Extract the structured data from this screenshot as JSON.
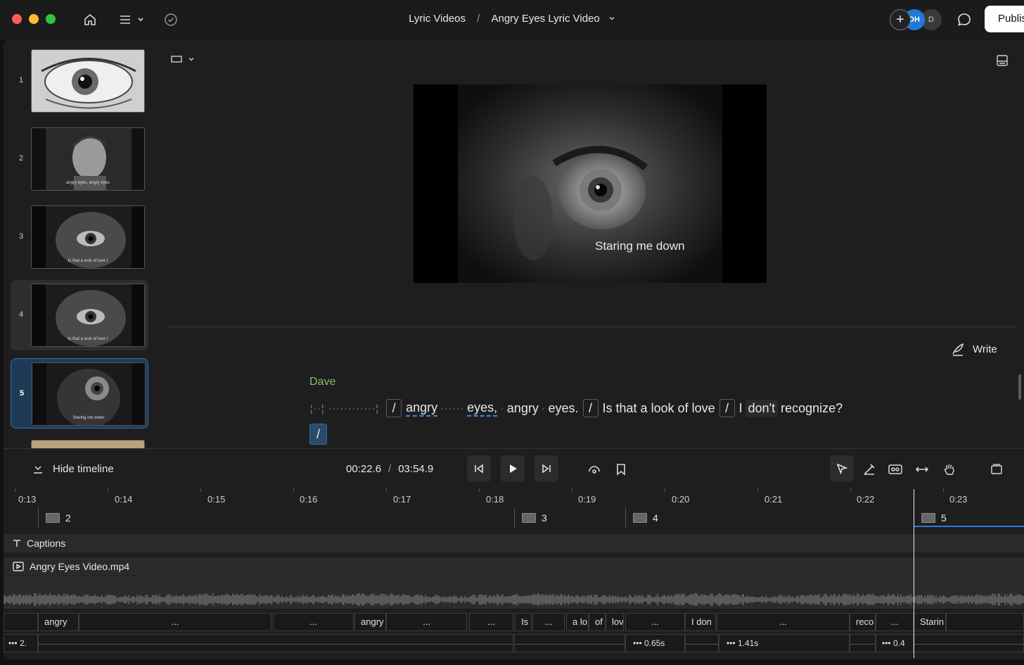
{
  "titlebar": {
    "breadcrumb_parent": "Lyric Videos",
    "breadcrumb_separator": "/",
    "breadcrumb_current": "Angry Eyes Lyric Video",
    "avatar_initials_1": "DH",
    "avatar_initials_2": "D",
    "publish_label": "Publis"
  },
  "scenes": [
    {
      "number": "1",
      "caption": ""
    },
    {
      "number": "2",
      "caption": "angry eyes, angry eyes"
    },
    {
      "number": "3",
      "caption": "Is that a look of love I"
    },
    {
      "number": "4",
      "caption": "Is that a look of love I"
    },
    {
      "number": "5",
      "caption": "Staring me down"
    }
  ],
  "preview": {
    "caption": "Staring me down"
  },
  "script": {
    "write_label": "Write",
    "speaker": "Dave",
    "pause_1": "¦··¦ ············¦",
    "slash": "/",
    "word_1": "angry",
    "pause_2": "······",
    "word_2": "eyes,",
    "pause_3": "·",
    "word_3": "angry",
    "pause_4": "·",
    "word_4": "eyes.",
    "phrase_1": "Is that a look of love",
    "word_5": "I",
    "word_6": "don't",
    "word_7": "recognize?"
  },
  "transport": {
    "hide_timeline_label": "Hide timeline",
    "current_time": "00:22.6",
    "time_separator": "/",
    "total_time": "03:54.9"
  },
  "timeline": {
    "ruler_ticks": [
      "0:13",
      "0:14",
      "0:15",
      "0:16",
      "0:17",
      "0:18",
      "0:19",
      "0:20",
      "0:21",
      "0:22",
      "0:23"
    ],
    "scene_markers": [
      "2",
      "3",
      "4",
      "5"
    ],
    "captions_track": "Captions",
    "media_track": "Angry Eyes Video.mp4",
    "word_chips": [
      "angry",
      "...",
      "...",
      "angry",
      "...",
      "...",
      "Is",
      "...",
      "a lo",
      "of",
      "lov",
      "...",
      "I don",
      "...",
      "reco",
      "...",
      "Starin"
    ],
    "pause_chips": [
      "••• 2.",
      "••• 0.65s",
      "••• 1.41s",
      "••• 0.4"
    ]
  },
  "colors": {
    "accent_blue": "#2c7ad9",
    "speaker_green": "#7fbf6c",
    "selected_scene_bg": "#1f3a55"
  }
}
